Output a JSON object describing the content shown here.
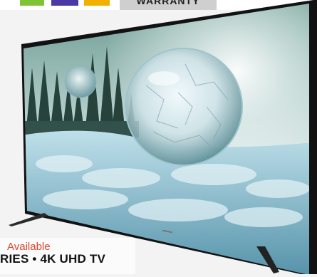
{
  "header": {
    "color_swatches": [
      "#7fc436",
      "#4b3aa6",
      "#f2b000"
    ],
    "warranty_label": "WARRANTY"
  },
  "product": {
    "availability": "Available",
    "series_text": "RIES • 4K UHD TV"
  }
}
